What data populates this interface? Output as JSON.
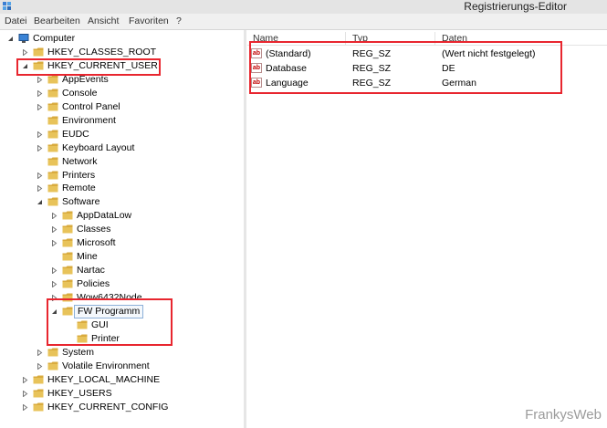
{
  "window": {
    "title": "Registrierungs-Editor",
    "app_icon": "regedit-icon"
  },
  "menu": [
    "Datei",
    "Bearbeiten",
    "Ansicht",
    "Favoriten",
    "?"
  ],
  "tree": [
    {
      "label": "Computer",
      "icon": "computer-icon",
      "expander": "expanded",
      "depth": 0
    },
    {
      "label": "HKEY_CLASSES_ROOT",
      "icon": "folder-icon",
      "expander": "collapsed",
      "depth": 1
    },
    {
      "label": "HKEY_CURRENT_USER",
      "icon": "folder-icon",
      "expander": "expanded",
      "depth": 1
    },
    {
      "label": "AppEvents",
      "icon": "folder-icon",
      "expander": "collapsed",
      "depth": 2
    },
    {
      "label": "Console",
      "icon": "folder-icon",
      "expander": "collapsed",
      "depth": 2
    },
    {
      "label": "Control Panel",
      "icon": "folder-icon",
      "expander": "collapsed",
      "depth": 2
    },
    {
      "label": "Environment",
      "icon": "folder-icon",
      "expander": "none",
      "depth": 2
    },
    {
      "label": "EUDC",
      "icon": "folder-icon",
      "expander": "collapsed",
      "depth": 2
    },
    {
      "label": "Keyboard Layout",
      "icon": "folder-icon",
      "expander": "collapsed",
      "depth": 2
    },
    {
      "label": "Network",
      "icon": "folder-icon",
      "expander": "none",
      "depth": 2
    },
    {
      "label": "Printers",
      "icon": "folder-icon",
      "expander": "collapsed",
      "depth": 2
    },
    {
      "label": "Remote",
      "icon": "folder-icon",
      "expander": "collapsed",
      "depth": 2
    },
    {
      "label": "Software",
      "icon": "folder-icon",
      "expander": "expanded",
      "depth": 2
    },
    {
      "label": "AppDataLow",
      "icon": "folder-icon",
      "expander": "collapsed",
      "depth": 3
    },
    {
      "label": "Classes",
      "icon": "folder-icon",
      "expander": "collapsed",
      "depth": 3
    },
    {
      "label": "Microsoft",
      "icon": "folder-icon",
      "expander": "collapsed",
      "depth": 3
    },
    {
      "label": "Mine",
      "icon": "folder-icon",
      "expander": "none",
      "depth": 3
    },
    {
      "label": "Nartac",
      "icon": "folder-icon",
      "expander": "collapsed",
      "depth": 3
    },
    {
      "label": "Policies",
      "icon": "folder-icon",
      "expander": "collapsed",
      "depth": 3
    },
    {
      "label": "Wow6432Node",
      "icon": "folder-icon",
      "expander": "collapsed",
      "depth": 3
    },
    {
      "label": "FW Programm",
      "icon": "folder-icon",
      "expander": "expanded",
      "depth": 3,
      "selected": true
    },
    {
      "label": "GUI",
      "icon": "folder-icon",
      "expander": "none",
      "depth": 4
    },
    {
      "label": "Printer",
      "icon": "folder-icon",
      "expander": "none",
      "depth": 4
    },
    {
      "label": "System",
      "icon": "folder-icon",
      "expander": "collapsed",
      "depth": 2
    },
    {
      "label": "Volatile Environment",
      "icon": "folder-icon",
      "expander": "collapsed",
      "depth": 2
    },
    {
      "label": "HKEY_LOCAL_MACHINE",
      "icon": "folder-icon",
      "expander": "collapsed",
      "depth": 1
    },
    {
      "label": "HKEY_USERS",
      "icon": "folder-icon",
      "expander": "collapsed",
      "depth": 1
    },
    {
      "label": "HKEY_CURRENT_CONFIG",
      "icon": "folder-icon",
      "expander": "collapsed",
      "depth": 1
    }
  ],
  "values_list": {
    "columns": [
      "Name",
      "Typ",
      "Daten"
    ],
    "rows": [
      {
        "icon": "string-value-icon",
        "name": "(Standard)",
        "type": "REG_SZ",
        "data": "(Wert nicht festgelegt)"
      },
      {
        "icon": "string-value-icon",
        "name": "Database",
        "type": "REG_SZ",
        "data": "DE"
      },
      {
        "icon": "string-value-icon",
        "name": "Language",
        "type": "REG_SZ",
        "data": "German"
      }
    ]
  },
  "annotation_color": "#e8262f",
  "folder_color": "#e8c35a",
  "watermark": "FrankysWeb"
}
